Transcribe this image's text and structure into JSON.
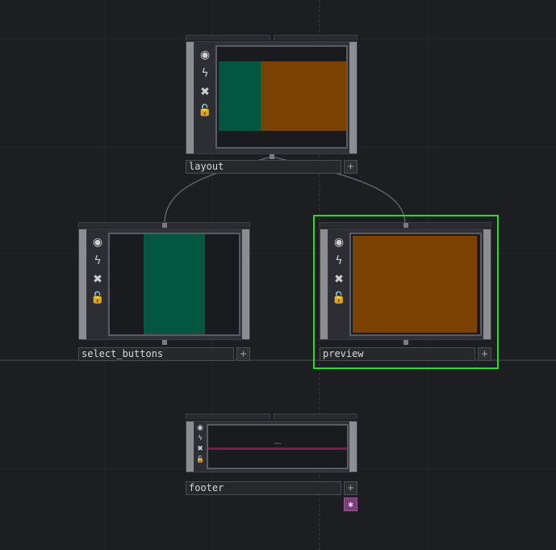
{
  "canvas": {
    "background": "#1d1e22"
  },
  "colors": {
    "teal": "#01573f",
    "orange": "#7a4100",
    "magenta_line": "#7a1b4a",
    "selection": "#22e022",
    "wire": "#5f6065"
  },
  "icons": {
    "viewer": "viewer-icon",
    "cook": "cook-icon",
    "bypass": "bypass-icon",
    "lock": "lock-icon",
    "add": "plus-icon"
  },
  "nodes": {
    "layout": {
      "name": "layout",
      "add_label": "+"
    },
    "select_buttons": {
      "name": "select_buttons",
      "add_label": "+"
    },
    "preview": {
      "name": "preview",
      "add_label": "+",
      "selected": true
    },
    "footer": {
      "name": "footer",
      "add_label": "+",
      "viewer_text": "~~~"
    }
  },
  "flag_badge": {
    "label": "✱"
  }
}
